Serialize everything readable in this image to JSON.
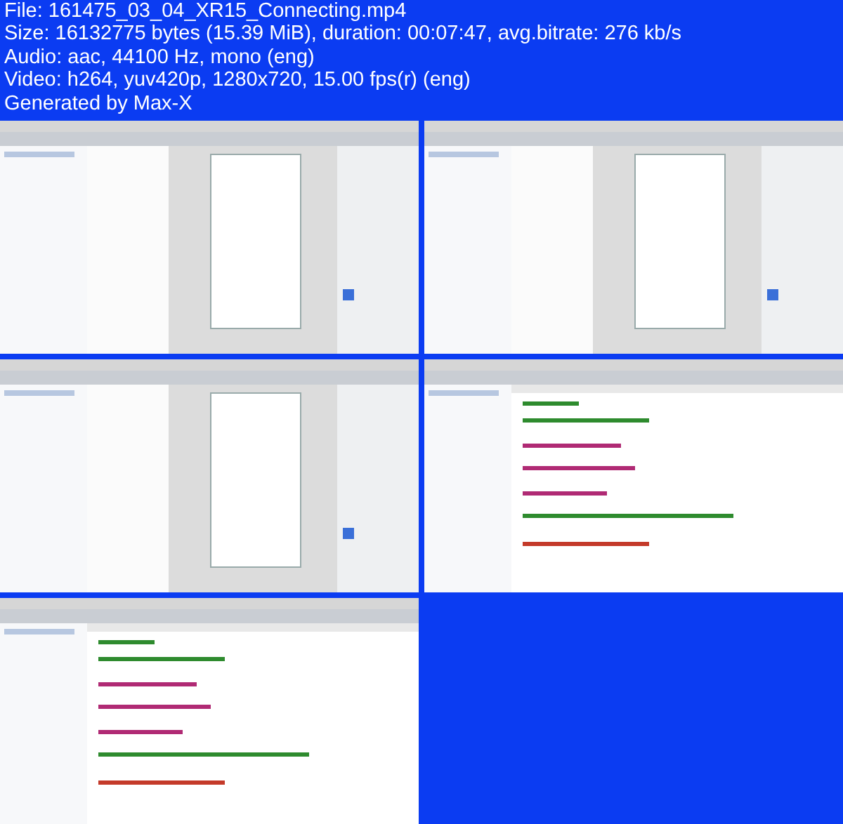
{
  "info_lines": [
    "File: 161475_03_04_XR15_Connecting.mp4",
    "Size: 16132775 bytes (15.39 MiB), duration: 00:07:47, avg.bitrate: 276 kb/s",
    "Audio: aac, 44100 Hz, mono (eng)",
    "Video: h264, yuv420p, 1280x720, 15.00 fps(r) (eng)",
    "Generated by Max-X"
  ]
}
